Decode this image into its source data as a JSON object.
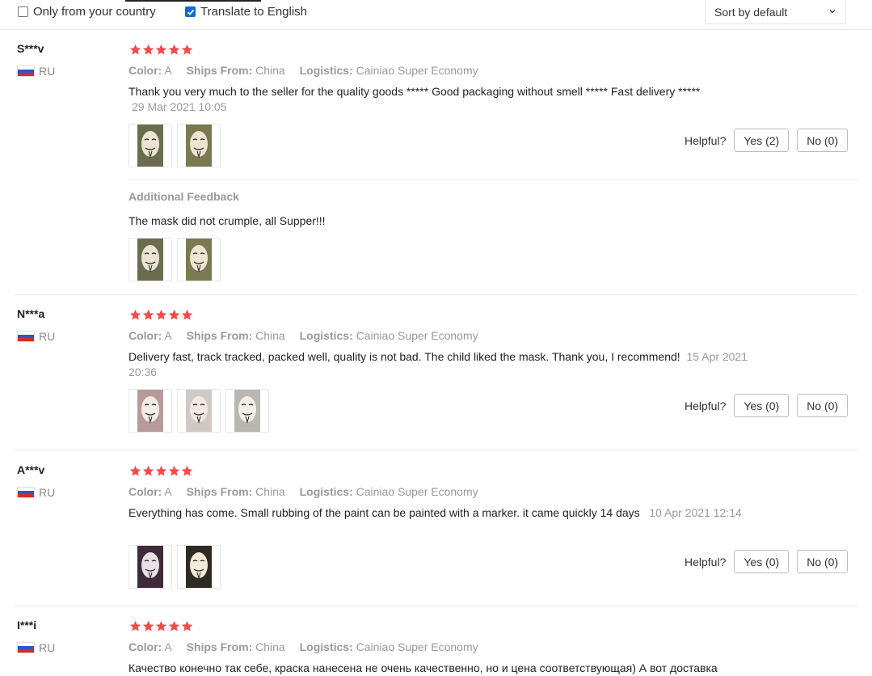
{
  "filters": {
    "country_label": "Only from your country",
    "country_checked": false,
    "translate_label": "Translate to English",
    "translate_checked": true,
    "sort_label": "Sort by default"
  },
  "labels": {
    "color": "Color:",
    "ships": "Ships From:",
    "logistics": "Logistics:",
    "helpful": "Helpful?",
    "additional": "Additional Feedback"
  },
  "reviews": [
    {
      "user": "S***v",
      "country": "RU",
      "rating": 5,
      "color": "A",
      "ships_from": "China",
      "logistics": "Cainiao Super Economy",
      "text": "Thank you very much to the seller for the quality goods ***** Good packaging without smell ***** Fast delivery *****",
      "date": "29 Mar 2021 10:05",
      "photos": 2,
      "yes": "Yes (2)",
      "no": "No (0)",
      "additional_text": "The mask did not crumple, all Supper!!!",
      "additional_photos": 2
    },
    {
      "user": "N***a",
      "country": "RU",
      "rating": 5,
      "color": "A",
      "ships_from": "China",
      "logistics": "Cainiao Super Economy",
      "text": "Delivery fast, track tracked, packed well, quality is not bad. The child liked the mask. Thank you, I recommend!",
      "date": "15 Apr 2021 20:36",
      "photos": 3,
      "yes": "Yes (0)",
      "no": "No (0)"
    },
    {
      "user": "A***v",
      "country": "RU",
      "rating": 5,
      "color": "A",
      "ships_from": "China",
      "logistics": "Cainiao Super Economy",
      "text": "Everything has come. Small rubbing of the paint can be painted with a marker. it came quickly 14 days",
      "date": "10 Apr 2021 12:14",
      "photos": 2,
      "yes": "Yes (0)",
      "no": "No (0)"
    },
    {
      "user": "I***i",
      "country": "RU",
      "rating": 5,
      "color": "A",
      "ships_from": "China",
      "logistics": "Cainiao Super Economy",
      "text": "Качество конечно так себе, краска нанесена не очень качественно, но и цена соответствующая) А вот доставка"
    }
  ],
  "colors": {
    "star": "#f44b4b",
    "checkbox": "#0b6dd3",
    "meta_text": "#999999"
  }
}
